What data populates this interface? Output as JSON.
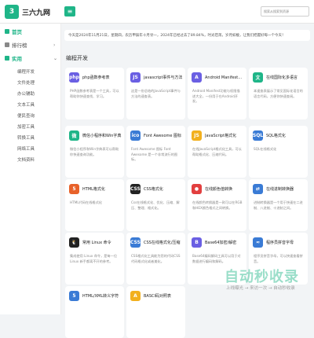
{
  "header": {
    "logo_mark": "3",
    "logo_text": "三六九网",
    "menu_icon": "hamburger-icon",
    "search_placeholder": "搜索从搜索到资源"
  },
  "sidebar": {
    "items": [
      {
        "label": "首页",
        "active": true
      },
      {
        "label": "排行榜",
        "active": false
      },
      {
        "label": "实用",
        "active": true
      }
    ],
    "subitems": [
      "编程开发",
      "文件处理",
      "办公辅助",
      "文本工具",
      "便民查询",
      "加密工具",
      "转换工具",
      "网络工具",
      "文档资料"
    ]
  },
  "notice": "今天是2024年11月21日，星期四，农历甲辰年十月廿一，2024年已经过去了89.84%，时光荏苒，岁月如梭，让我们把握好每一个今天！",
  "section_title": "编程开发",
  "cards": [
    {
      "title": "php函数参考表",
      "desc": "PHP函数参考表是一个工具，可以帮助你快速查找、学习。",
      "color": "#6a5fe3",
      "glyph": "php"
    },
    {
      "title": "javascript事件与方法",
      "desc": "这是一份总结的JavaScript事件与方法的速查表。",
      "color": "#6a5fe3",
      "glyph": "JS"
    },
    {
      "title": "Android Manifest功能与权限",
      "desc": "Android Manifest功能与权限描述大全，一份用于在Android开发。",
      "color": "#6a5fe3",
      "glyph": "A"
    },
    {
      "title": "在线国际化多语言",
      "desc": "本速查表展示了常见国际化语言的语言代码，方便你快速查阅。",
      "color": "#1fb588",
      "glyph": "文"
    },
    {
      "title": "微信小程序和Win字典",
      "desc": "微信小程序和Win字典表可以帮助你快速查询功能。",
      "color": "#1fb588",
      "glyph": "微"
    },
    {
      "title": "Font Awesome 图标",
      "desc": "Font Awesome 图标 Font Awesome 是一个非常流行的图标。",
      "color": "#3a7bd5",
      "glyph": "ico"
    },
    {
      "title": "JavaScript格式化",
      "desc": "在线JavaScript格式化工具，可以帮助格式化、压缩代码。",
      "color": "#f2b01e",
      "glyph": "JS"
    },
    {
      "title": "SQL格式化",
      "desc": "SQL在线格式化",
      "color": "#3a7bd5",
      "glyph": "SQL"
    },
    {
      "title": "HTML格式化",
      "desc": "HTML代码在线格式化",
      "color": "#e8622a",
      "glyph": "5"
    },
    {
      "title": "CSS格式化",
      "desc": "Css在线格式化、优化、压缩、解压、整理、格式化。",
      "color": "#222",
      "glyph": "CSS"
    },
    {
      "title": "在线颜色值转换",
      "desc": "在线颜色转换器是一款可以在RGB和HEX颜色格式之间转换。",
      "color": "#e23f3f",
      "glyph": "●"
    },
    {
      "title": "在线进制转换器",
      "desc": "进制转换器是一个用于快速在二进制、八进制、十进制之间。",
      "color": "#3a7bd5",
      "glyph": "⇄"
    },
    {
      "title": "常用 Linux 命令",
      "desc": "集成使用 Linux 命令，是每一位Linux 新手都离不开的参考。",
      "color": "#222",
      "glyph": "🐧"
    },
    {
      "title": "CSS在线格式化/压缩",
      "desc": "CSS格式化工具能为您的代码CSS代码格式化或者美化。",
      "color": "#3a7bd5",
      "glyph": "CSS"
    },
    {
      "title": "Base64加密/解密",
      "desc": "Base64编码解码工具可以用于对数据进行编码和解码。",
      "color": "#6a5fe3",
      "glyph": "B"
    },
    {
      "title": "程序员拼音字母",
      "desc": "程序员拼音字母，可以快速查看拼音。",
      "color": "#3a7bd5",
      "glyph": "≈"
    },
    {
      "title": "HTML/XML转义字符",
      "desc": "",
      "color": "#3a7bd5",
      "glyph": "5"
    },
    {
      "title": "BASCI码对照表",
      "desc": "",
      "color": "#f2b01e",
      "glyph": "A"
    }
  ],
  "watermark": {
    "logo": "自动秒收录",
    "sub": "上线曝光 → 来访一次 → 自动秒收录"
  }
}
